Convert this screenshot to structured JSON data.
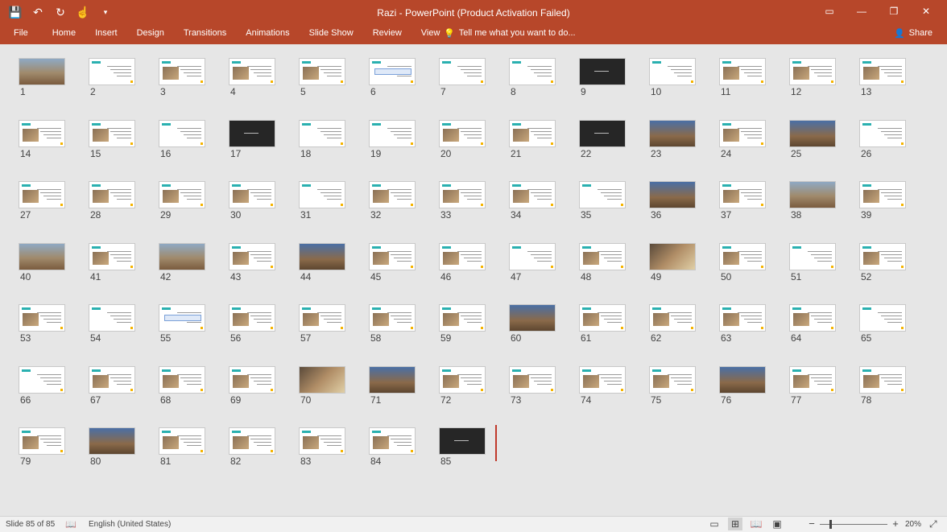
{
  "app": {
    "title": "Razi  -  PowerPoint (Product Activation Failed)"
  },
  "quick_access": {
    "icons": [
      "save-icon",
      "undo-icon",
      "redo-icon",
      "touch-mode-icon",
      "customize-icon"
    ]
  },
  "window_controls": {
    "ribbon_display": "▭",
    "minimize": "—",
    "restore": "❐",
    "close": "✕"
  },
  "ribbon": {
    "tabs": [
      "File",
      "Home",
      "Insert",
      "Design",
      "Transitions",
      "Animations",
      "Slide Show",
      "Review",
      "View"
    ],
    "tell_me": "Tell me what you want to do...",
    "share": "Share"
  },
  "sorter": {
    "slides": [
      {
        "n": "1",
        "kind": "photo"
      },
      {
        "n": "2",
        "kind": "text"
      },
      {
        "n": "3",
        "kind": "imgtext"
      },
      {
        "n": "4",
        "kind": "imgtext"
      },
      {
        "n": "5",
        "kind": "imgtext"
      },
      {
        "n": "6",
        "kind": "diagram"
      },
      {
        "n": "7",
        "kind": "text"
      },
      {
        "n": "8",
        "kind": "text"
      },
      {
        "n": "9",
        "kind": "dark"
      },
      {
        "n": "10",
        "kind": "text"
      },
      {
        "n": "11",
        "kind": "imgtext"
      },
      {
        "n": "12",
        "kind": "imgtext"
      },
      {
        "n": "13",
        "kind": "imgtext"
      },
      {
        "n": "14",
        "kind": "imgtext"
      },
      {
        "n": "15",
        "kind": "imgtext"
      },
      {
        "n": "16",
        "kind": "text"
      },
      {
        "n": "17",
        "kind": "dark"
      },
      {
        "n": "18",
        "kind": "text"
      },
      {
        "n": "19",
        "kind": "text"
      },
      {
        "n": "20",
        "kind": "imgtext"
      },
      {
        "n": "21",
        "kind": "imgtext"
      },
      {
        "n": "22",
        "kind": "dark"
      },
      {
        "n": "23",
        "kind": "photo3"
      },
      {
        "n": "24",
        "kind": "imgtext"
      },
      {
        "n": "25",
        "kind": "photo3"
      },
      {
        "n": "26",
        "kind": "text"
      },
      {
        "n": "27",
        "kind": "imgtext"
      },
      {
        "n": "28",
        "kind": "imgtext"
      },
      {
        "n": "29",
        "kind": "imgtext"
      },
      {
        "n": "30",
        "kind": "imgtext"
      },
      {
        "n": "31",
        "kind": "text"
      },
      {
        "n": "32",
        "kind": "imgtext"
      },
      {
        "n": "33",
        "kind": "imgtext"
      },
      {
        "n": "34",
        "kind": "imgtext"
      },
      {
        "n": "35",
        "kind": "text"
      },
      {
        "n": "36",
        "kind": "photo3"
      },
      {
        "n": "37",
        "kind": "imgtext"
      },
      {
        "n": "38",
        "kind": "photo"
      },
      {
        "n": "39",
        "kind": "imgtext"
      },
      {
        "n": "40",
        "kind": "photo"
      },
      {
        "n": "41",
        "kind": "imgtext"
      },
      {
        "n": "42",
        "kind": "photo"
      },
      {
        "n": "43",
        "kind": "imgtext"
      },
      {
        "n": "44",
        "kind": "photo3"
      },
      {
        "n": "45",
        "kind": "imgtext"
      },
      {
        "n": "46",
        "kind": "imgtext"
      },
      {
        "n": "47",
        "kind": "text"
      },
      {
        "n": "48",
        "kind": "imgtext"
      },
      {
        "n": "49",
        "kind": "photo2"
      },
      {
        "n": "50",
        "kind": "imgtext"
      },
      {
        "n": "51",
        "kind": "text"
      },
      {
        "n": "52",
        "kind": "imgtext"
      },
      {
        "n": "53",
        "kind": "imgtext"
      },
      {
        "n": "54",
        "kind": "text"
      },
      {
        "n": "55",
        "kind": "diagram"
      },
      {
        "n": "56",
        "kind": "imgtext"
      },
      {
        "n": "57",
        "kind": "imgtext"
      },
      {
        "n": "58",
        "kind": "imgtext"
      },
      {
        "n": "59",
        "kind": "imgtext"
      },
      {
        "n": "60",
        "kind": "photo3"
      },
      {
        "n": "61",
        "kind": "imgtext"
      },
      {
        "n": "62",
        "kind": "imgtext"
      },
      {
        "n": "63",
        "kind": "imgtext"
      },
      {
        "n": "64",
        "kind": "imgtext"
      },
      {
        "n": "65",
        "kind": "text"
      },
      {
        "n": "66",
        "kind": "text"
      },
      {
        "n": "67",
        "kind": "imgtext"
      },
      {
        "n": "68",
        "kind": "imgtext"
      },
      {
        "n": "69",
        "kind": "imgtext"
      },
      {
        "n": "70",
        "kind": "photo2"
      },
      {
        "n": "71",
        "kind": "photo3"
      },
      {
        "n": "72",
        "kind": "imgtext"
      },
      {
        "n": "73",
        "kind": "imgtext"
      },
      {
        "n": "74",
        "kind": "imgtext"
      },
      {
        "n": "75",
        "kind": "imgtext"
      },
      {
        "n": "76",
        "kind": "photo3"
      },
      {
        "n": "77",
        "kind": "imgtext"
      },
      {
        "n": "78",
        "kind": "imgtext"
      },
      {
        "n": "79",
        "kind": "imgtext"
      },
      {
        "n": "80",
        "kind": "photo3"
      },
      {
        "n": "81",
        "kind": "imgtext"
      },
      {
        "n": "82",
        "kind": "imgtext"
      },
      {
        "n": "83",
        "kind": "imgtext"
      },
      {
        "n": "84",
        "kind": "imgtext"
      },
      {
        "n": "85",
        "kind": "dark"
      }
    ]
  },
  "status": {
    "slide_indicator": "Slide 85 of 85",
    "language": "English (United States)",
    "zoom_percent": "20%",
    "zoom_level": 20,
    "active_view": "slide-sorter"
  },
  "colors": {
    "accent": "#b7472a",
    "thumb_bar": "#2ab0b0",
    "thumb_dot": "#f5b400",
    "sorter_bg": "#e6e6e6"
  }
}
